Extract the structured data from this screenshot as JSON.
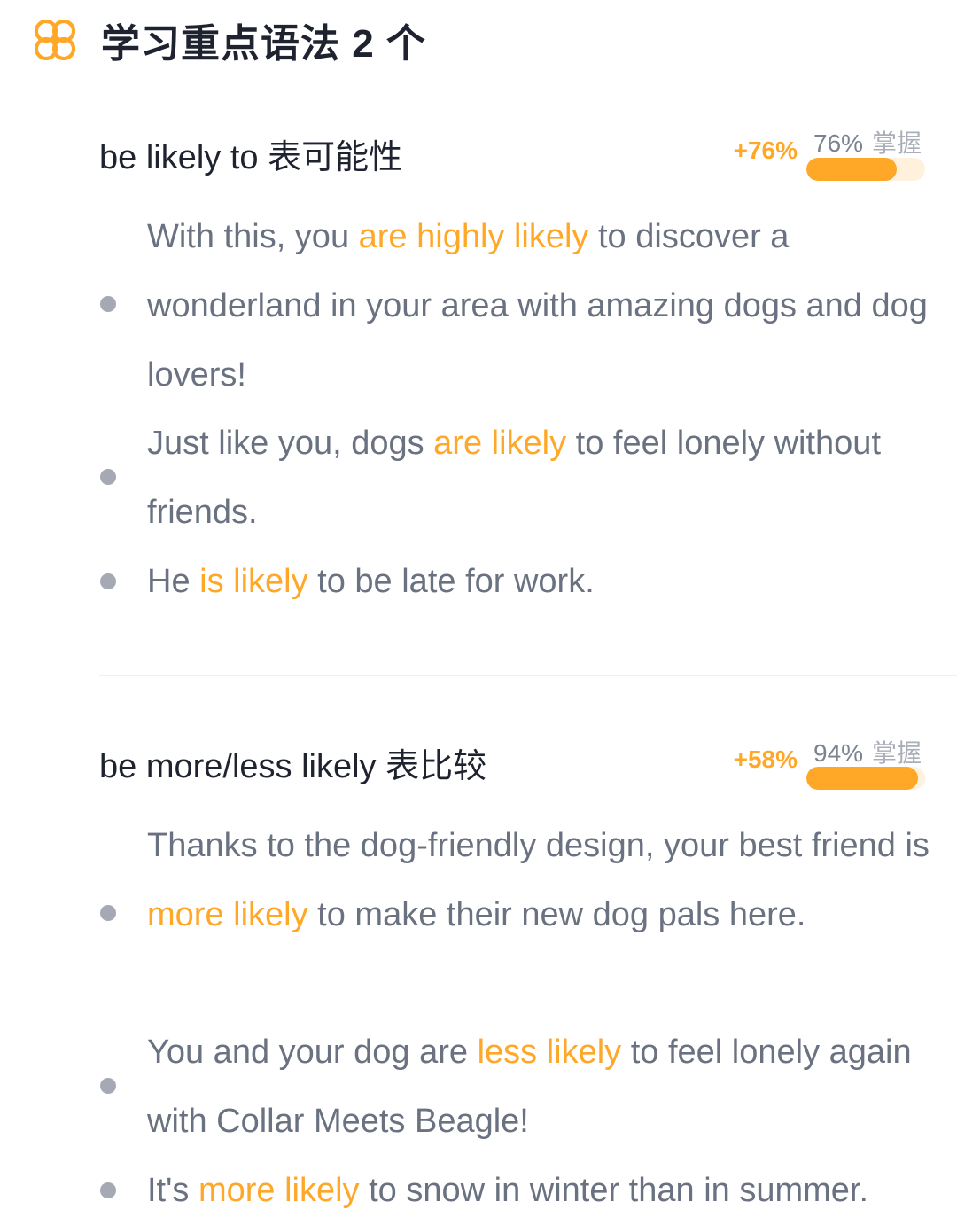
{
  "header": {
    "icon": "grammar-flower-icon",
    "accent": "#ffa727",
    "title": "学习重点语法 2 个"
  },
  "sections": [
    {
      "title": "be likely to 表可能性",
      "delta": "+76%",
      "mastery_pct": "76%",
      "mastery_word": "掌握",
      "progress": 0.76,
      "examples": [
        {
          "before": "With this, you ",
          "highlight": "are highly likely",
          "after": " to discover a wonderland in your area with amazing dogs and dog lovers!"
        },
        {
          "before": "Just like you, dogs ",
          "highlight": "are likely",
          "after": " to feel lonely without friends."
        },
        {
          "before": "He ",
          "highlight": "is likely",
          "after": " to be late for work."
        }
      ]
    },
    {
      "title": "be more/less likely 表比较",
      "delta": "+58%",
      "mastery_pct": "94%",
      "mastery_word": "掌握",
      "progress": 0.94,
      "examples": [
        {
          "before": "Thanks to the dog-friendly design, your best friend is ",
          "highlight": "more likely",
          "after": " to make their new dog pals here."
        },
        {
          "before": "You and your dog are ",
          "highlight": "less likely",
          "after": " to feel lonely again with Collar Meets Beagle!"
        },
        {
          "before": "It's ",
          "highlight": "more likely",
          "after": " to snow in winter than in summer."
        }
      ]
    }
  ]
}
